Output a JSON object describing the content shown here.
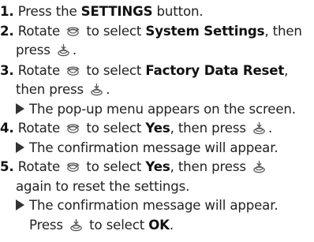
{
  "steps": [
    {
      "num": "1.",
      "pre": "Press the ",
      "bold": "SETTINGS",
      "post": " button."
    },
    {
      "num": "2.",
      "pre": "Rotate",
      "mid": "to select ",
      "bold": "System Settings",
      "post": ", then",
      "cont": "press"
    },
    {
      "num": "3.",
      "pre": "Rotate",
      "mid": "to select ",
      "bold": "Factory Data Reset",
      "post": ",",
      "cont": "then press",
      "result": "The pop-up menu appears on the screen."
    },
    {
      "num": "4.",
      "pre": "Rotate",
      "mid": "to select ",
      "bold": "Yes",
      "post": ", then press",
      "result": "The confirmation message will appear."
    },
    {
      "num": "5.",
      "pre": "Rotate",
      "mid": "to select ",
      "bold": "Yes",
      "post": ", then press",
      "cont": "again to reset the settings.",
      "result": "The confirmation message will appear.",
      "result2_pre": "Press",
      "result2_mid": "to select ",
      "result2_bold": "OK",
      "result2_post": "."
    }
  ],
  "icons": {
    "rotate": "interface-dial-rotate-icon",
    "press": "interface-dial-press-icon"
  },
  "colors": {
    "text": "#222222",
    "bold": "#111111",
    "icon": "#555555"
  }
}
